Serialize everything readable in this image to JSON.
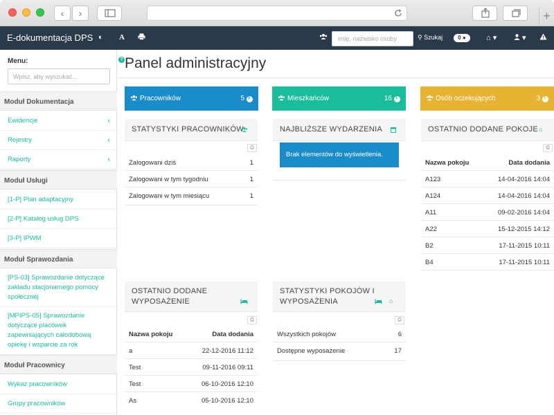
{
  "app": {
    "brand": "E-dokumentacja DPS",
    "search_placeholder": "imię, nazwisko osoby",
    "search_button": "Szukaj",
    "notification_count": "0"
  },
  "sidebar": {
    "menu_label": "Menu:",
    "search_placeholder": "Wpisz, aby wyszukać...",
    "sections": [
      {
        "title": "Moduł Dokumentacja"
      },
      {
        "title": "Moduł Usługi"
      },
      {
        "title": "Moduł Sprawozdania"
      },
      {
        "title": "Moduł Pracownicy"
      }
    ],
    "items": [
      {
        "label": "Ewidencje"
      },
      {
        "label": "Rejestry"
      },
      {
        "label": "Raporty"
      },
      {
        "label": "[1-P] Plan adaptacyjny"
      },
      {
        "label": "[2-P] Katalog usług DPS"
      },
      {
        "label": "[3-P] IPWM"
      },
      {
        "label": "[PS-03] Sprawozdanie dotyczące zakładu stacjonarnego pomocy społecznej"
      },
      {
        "label": "[MPIPS-05] Sprawozdanie dotyczące placówek zapewniających całodobową opiekę i wsparcie za rok"
      },
      {
        "label": "Wykaz pracowników"
      },
      {
        "label": "Grupy pracowników"
      }
    ]
  },
  "main": {
    "title": "Panel administracyjny",
    "tiles": [
      {
        "label": "Pracowników",
        "count": "5",
        "color": "#1a8cc9"
      },
      {
        "label": "Mieszkańców",
        "count": "16",
        "color": "#1abc9c"
      },
      {
        "label": "Osób oczekujących",
        "count": "3",
        "color": "#e8b333"
      }
    ],
    "staff_stats": {
      "title": "STATYSTYKI PRACOWNIKÓW",
      "rows": [
        {
          "label": "Zalogowani dziś",
          "value": "1"
        },
        {
          "label": "Zalogowani w tym tygodniu",
          "value": "1"
        },
        {
          "label": "Zalogowani w tym miesiącu",
          "value": "1"
        }
      ]
    },
    "events": {
      "title": "NAJBLIŻSZE WYDARZENIA",
      "empty": "Brak elementów do wyświetlenia."
    },
    "rooms": {
      "title": "OSTATNIO DODANE POKOJE",
      "col_room": "Nazwa pokoju",
      "col_date": "Data dodania",
      "rows": [
        {
          "room": "A123",
          "date": "14-04-2016 14:04"
        },
        {
          "room": "A124",
          "date": "14-04-2016 14:04"
        },
        {
          "room": "A11",
          "date": "09-02-2016 14:04"
        },
        {
          "room": "A22",
          "date": "15-12-2015 14:12"
        },
        {
          "room": "B2",
          "date": "17-11-2015 10:11"
        },
        {
          "room": "B4",
          "date": "17-11-2015 10:11"
        }
      ]
    },
    "equipment": {
      "title_line1": "OSTATNIO DODANE",
      "title_line2": "WYPOSAŻENIE",
      "col_room": "Nazwa pokoju",
      "col_date": "Data dodania",
      "rows": [
        {
          "room": "a",
          "date": "22-12-2016 11:12"
        },
        {
          "room": "Test",
          "date": "09-11-2016 09:11"
        },
        {
          "room": "Test",
          "date": "06-10-2016 12:10"
        },
        {
          "room": "As",
          "date": "05-10-2016 12:10"
        }
      ]
    },
    "room_stats": {
      "title_line1": "STATYSTYKI POKOJÓW I",
      "title_line2": "WYPOSAŻENIA",
      "rows": [
        {
          "label": "Wszystkich pokojów",
          "value": "6"
        },
        {
          "label": "Dostępne wyposażenie",
          "value": "17"
        }
      ]
    }
  }
}
